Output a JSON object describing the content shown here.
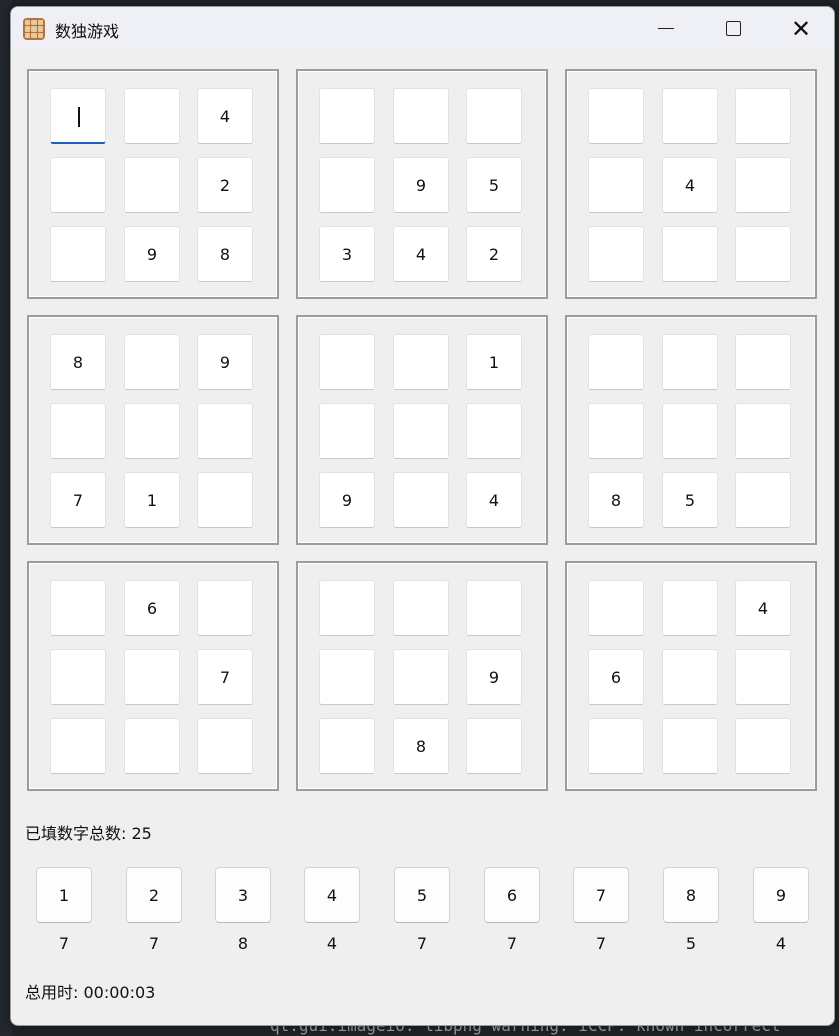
{
  "window": {
    "title": "数独游戏"
  },
  "board": {
    "boxes": [
      [
        "",
        "",
        "4",
        "",
        "",
        "2",
        "",
        "9",
        "8"
      ],
      [
        "",
        "",
        "",
        "",
        "9",
        "5",
        "3",
        "4",
        "2"
      ],
      [
        "",
        "",
        "",
        "",
        "4",
        "",
        "",
        "",
        ""
      ],
      [
        "8",
        "",
        "9",
        "",
        "",
        "",
        "7",
        "1",
        ""
      ],
      [
        "",
        "",
        "1",
        "",
        "",
        "",
        "9",
        "",
        "4"
      ],
      [
        "",
        "",
        "",
        "",
        "",
        "",
        "8",
        "5",
        ""
      ],
      [
        "",
        "6",
        "",
        "",
        "",
        "7",
        "",
        "",
        ""
      ],
      [
        "",
        "",
        "",
        "",
        "",
        "9",
        "",
        "8",
        ""
      ],
      [
        "",
        "",
        "4",
        "6",
        "",
        "",
        "",
        "",
        ""
      ]
    ],
    "active_cell": {
      "box": 0,
      "cell": 0
    }
  },
  "stats": {
    "filled_total": "已填数字总数: 25",
    "total_time": "总用时: 00:00:03"
  },
  "number_pad": [
    {
      "label": "1",
      "count": "7"
    },
    {
      "label": "2",
      "count": "7"
    },
    {
      "label": "3",
      "count": "8"
    },
    {
      "label": "4",
      "count": "4"
    },
    {
      "label": "5",
      "count": "7"
    },
    {
      "label": "6",
      "count": "7"
    },
    {
      "label": "7",
      "count": "7"
    },
    {
      "label": "8",
      "count": "5"
    },
    {
      "label": "9",
      "count": "4"
    }
  ],
  "background_terminal": {
    "text": "qt.gui.imageio: libpng warning: iCCP: known incorrect"
  },
  "colors": {
    "accent": "#1b5fc1",
    "window_bg": "#efefef",
    "cell_bg": "#ffffff"
  }
}
